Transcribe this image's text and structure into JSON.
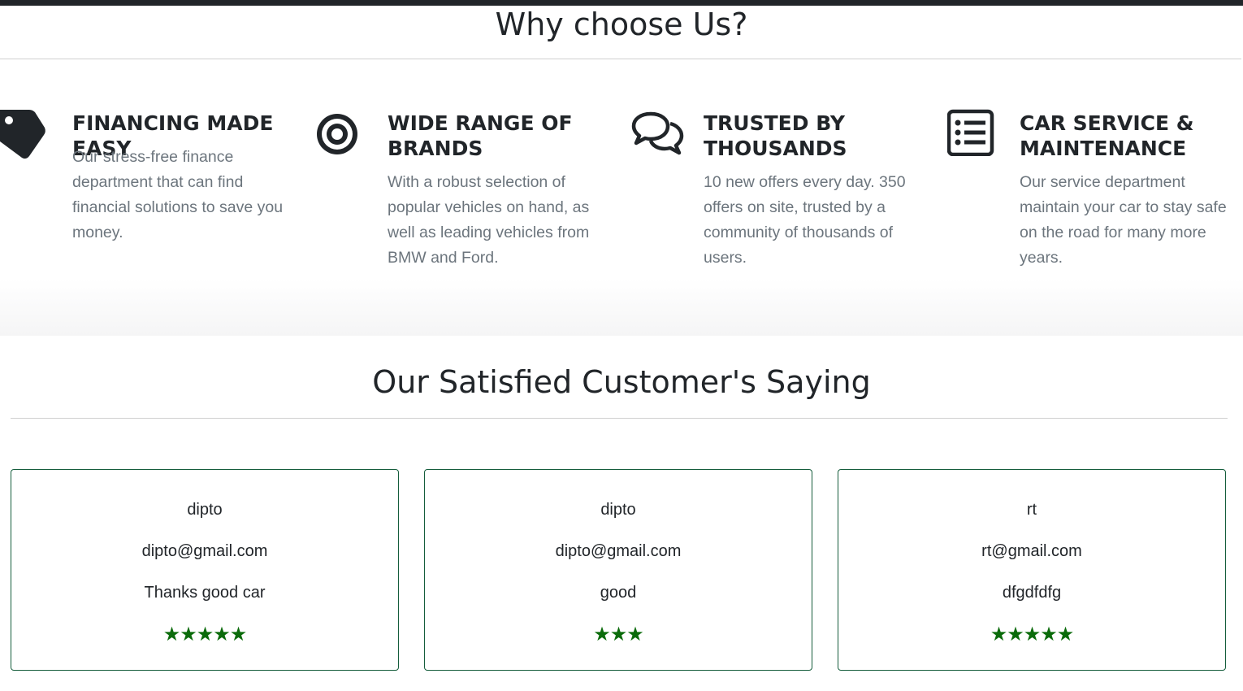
{
  "why_section": {
    "title": "Why choose Us?",
    "features": [
      {
        "icon": "tag-icon",
        "title": "FINANCING MADE EASY",
        "text": "Our stress-free finance department that can find financial solutions to save you money."
      },
      {
        "icon": "bullseye-icon",
        "title": "WIDE RANGE OF BRANDS",
        "text": "With a robust selection of popular vehicles on hand, as well as leading vehicles from BMW and Ford."
      },
      {
        "icon": "comments-icon",
        "title": "TRUSTED BY THOUSANDS",
        "text": "10 new offers every day. 350 offers on site, trusted by a community of thousands of users."
      },
      {
        "icon": "list-alt-icon",
        "title": "CAR SERVICE & MAINTENANCE",
        "text": "Our service department maintain your car to stay safe on the road for many more years."
      }
    ]
  },
  "customers_section": {
    "title": "Our Satisfied Customer's Saying",
    "star_color": "#0b6b0b",
    "reviews": [
      {
        "name": "dipto",
        "email": "dipto@gmail.com",
        "comment": "Thanks good car",
        "rating": 5
      },
      {
        "name": "dipto",
        "email": "dipto@gmail.com",
        "comment": "good",
        "rating": 3
      },
      {
        "name": "rt",
        "email": "rt@gmail.com",
        "comment": "dfgdfdfg",
        "rating": 5
      }
    ]
  }
}
